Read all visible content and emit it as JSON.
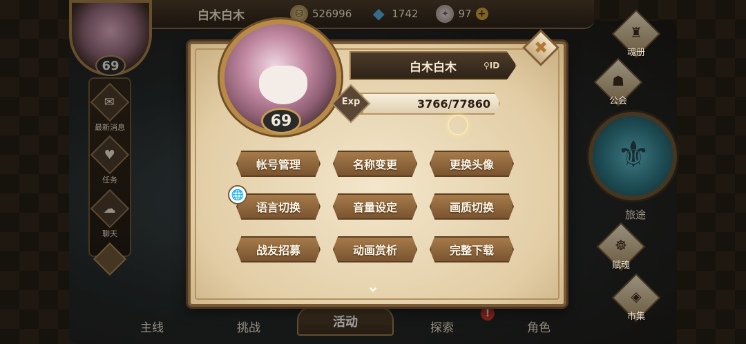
{
  "player": {
    "name": "白木白木",
    "level": "69"
  },
  "resources": {
    "coins": "526996",
    "crystals": "1742",
    "gems": "97"
  },
  "left_sidebar": {
    "items": [
      {
        "label": "最新消息",
        "icon": "gift-icon"
      },
      {
        "label": "任务",
        "icon": "shield-icon"
      },
      {
        "label": "聊天",
        "icon": "chat-icon"
      }
    ]
  },
  "right_sidebar": {
    "items": [
      {
        "label": "魂册",
        "icon": "book-icon"
      },
      {
        "label": "公会",
        "icon": "guild-icon"
      },
      {
        "label": "旅途",
        "icon": "journey-emblem-icon"
      },
      {
        "label": "赋魂",
        "icon": "flame-icon"
      },
      {
        "label": "市集",
        "icon": "market-icon"
      }
    ]
  },
  "bottom_tabs": {
    "items": [
      "主线",
      "挑战",
      "活动",
      "探索",
      "角色"
    ],
    "active": "活动",
    "alert": "!"
  },
  "profile_modal": {
    "name": "白木白木",
    "id_label": "ID",
    "level": "69",
    "exp_label": "Exp",
    "exp_text": "3766/77860",
    "exp_current": 3766,
    "exp_max": 77860,
    "buttons": [
      "帐号管理",
      "名称变更",
      "更换头像",
      "语言切换",
      "音量设定",
      "画质切换",
      "战友招募",
      "动画赏析",
      "完整下载"
    ]
  }
}
